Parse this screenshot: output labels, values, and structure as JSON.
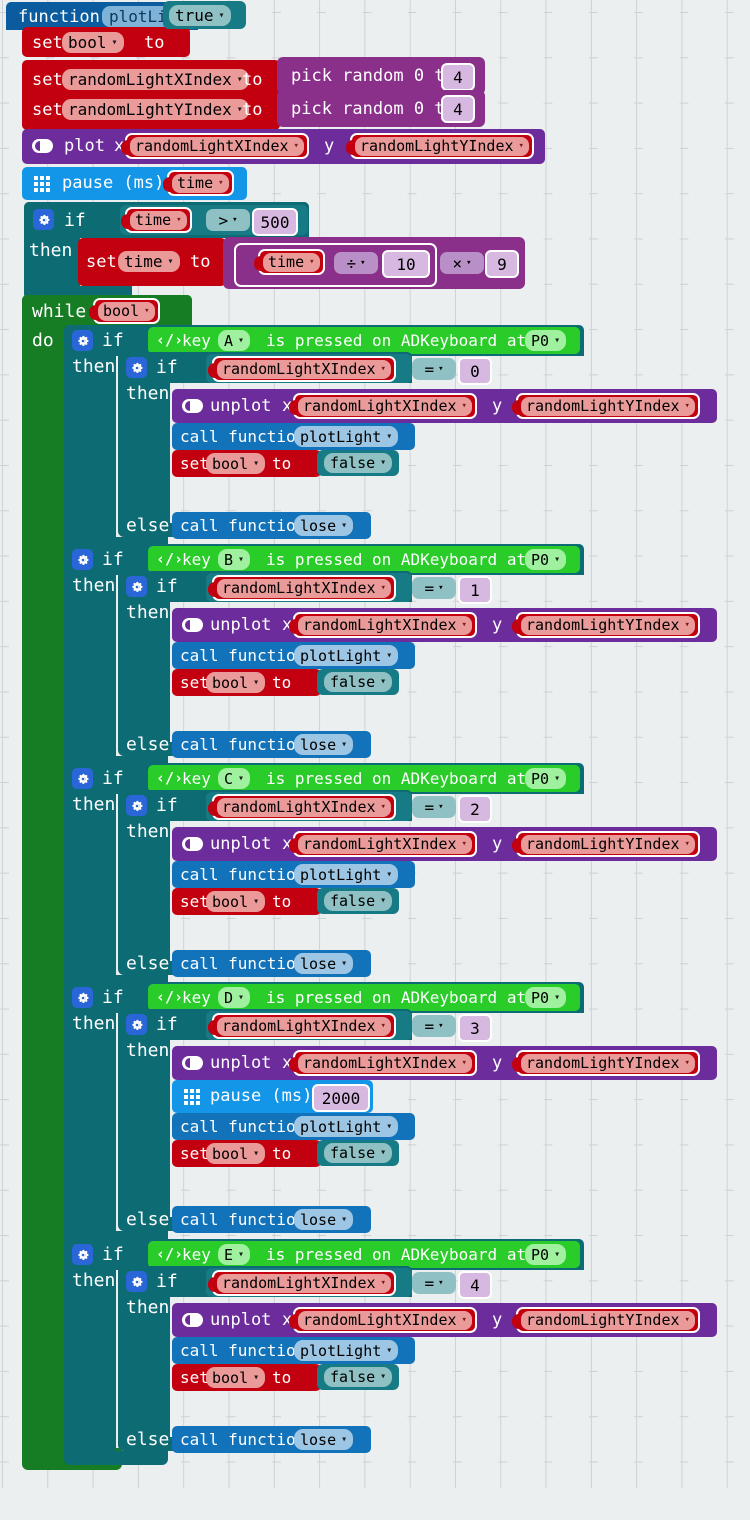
{
  "workspace": {
    "background_color": "#eceff0",
    "grid_dot_color": "#cdd2d4"
  },
  "palette": {
    "function": "#0b5c9e",
    "variables": "#c2000f",
    "logic": "#177b86",
    "led": "#6c2c9c",
    "basic": "#1396e8",
    "loops": "#177d25",
    "control": "#0d6b74",
    "extension": "#29cc29",
    "math": "#8a2f8a",
    "call": "#1273ba"
  },
  "function_block": {
    "keyword": "function",
    "name": "plotLight"
  },
  "setup": {
    "set_bool": {
      "keyword": "set",
      "variable": "bool",
      "to": "to",
      "value": "true"
    },
    "set_x": {
      "keyword": "set",
      "variable": "randomLightXIndex",
      "to": "to",
      "random": {
        "label": "pick random 0 to",
        "max": "4"
      }
    },
    "set_y": {
      "keyword": "set",
      "variable": "randomLightYIndex",
      "to": "to",
      "random": {
        "label": "pick random 0 to",
        "max": "4"
      }
    },
    "plot": {
      "label": "plot",
      "x_label": "x",
      "x_var": "randomLightXIndex",
      "y_label": "y",
      "y_var": "randomLightYIndex"
    },
    "pause": {
      "label": "pause (ms)",
      "value": "time"
    }
  },
  "time_if": {
    "if": "if",
    "then": "then",
    "condition": {
      "left": "time",
      "operator": ">",
      "right": "500"
    },
    "body": {
      "keyword": "set",
      "variable": "time",
      "to": "to",
      "expr": {
        "left": "time",
        "op1": "÷",
        "mid": "10",
        "op2": "×",
        "right": "9"
      }
    }
  },
  "while_loop": {
    "while": "while",
    "do": "do",
    "condition": "bool"
  },
  "key_branches": [
    {
      "if": "if",
      "then": "then",
      "else": "else",
      "key_label_pre": "key",
      "key": "A",
      "key_label_post": "is pressed on ADKeyboard at pin",
      "pin": "P0",
      "inner_if": "if",
      "inner_then": "then",
      "compare": {
        "left": "randomLightXIndex",
        "operator": "=",
        "right": "0"
      },
      "unplot": {
        "label": "unplot",
        "x_label": "x",
        "x_var": "randomLightXIndex",
        "y_label": "y",
        "y_var": "randomLightYIndex"
      },
      "pause": null,
      "call_plot": {
        "label": "call function",
        "name": "plotLight"
      },
      "set_bool": {
        "keyword": "set",
        "variable": "bool",
        "to": "to",
        "value": "false"
      },
      "call_lose": {
        "label": "call function",
        "name": "lose"
      }
    },
    {
      "if": "if",
      "then": "then",
      "else": "else",
      "key_label_pre": "key",
      "key": "B",
      "key_label_post": "is pressed on ADKeyboard at pin",
      "pin": "P0",
      "inner_if": "if",
      "inner_then": "then",
      "compare": {
        "left": "randomLightXIndex",
        "operator": "=",
        "right": "1"
      },
      "unplot": {
        "label": "unplot",
        "x_label": "x",
        "x_var": "randomLightXIndex",
        "y_label": "y",
        "y_var": "randomLightYIndex"
      },
      "pause": null,
      "call_plot": {
        "label": "call function",
        "name": "plotLight"
      },
      "set_bool": {
        "keyword": "set",
        "variable": "bool",
        "to": "to",
        "value": "false"
      },
      "call_lose": {
        "label": "call function",
        "name": "lose"
      }
    },
    {
      "if": "if",
      "then": "then",
      "else": "else",
      "key_label_pre": "key",
      "key": "C",
      "key_label_post": "is pressed on ADKeyboard at pin",
      "pin": "P0",
      "inner_if": "if",
      "inner_then": "then",
      "compare": {
        "left": "randomLightXIndex",
        "operator": "=",
        "right": "2"
      },
      "unplot": {
        "label": "unplot",
        "x_label": "x",
        "x_var": "randomLightXIndex",
        "y_label": "y",
        "y_var": "randomLightYIndex"
      },
      "pause": null,
      "call_plot": {
        "label": "call function",
        "name": "plotLight"
      },
      "set_bool": {
        "keyword": "set",
        "variable": "bool",
        "to": "to",
        "value": "false"
      },
      "call_lose": {
        "label": "call function",
        "name": "lose"
      }
    },
    {
      "if": "if",
      "then": "then",
      "else": "else",
      "key_label_pre": "key",
      "key": "D",
      "key_label_post": "is pressed on ADKeyboard at pin",
      "pin": "P0",
      "inner_if": "if",
      "inner_then": "then",
      "compare": {
        "left": "randomLightXIndex",
        "operator": "=",
        "right": "3"
      },
      "unplot": {
        "label": "unplot",
        "x_label": "x",
        "x_var": "randomLightXIndex",
        "y_label": "y",
        "y_var": "randomLightYIndex"
      },
      "pause": {
        "label": "pause (ms)",
        "value": "2000"
      },
      "call_plot": {
        "label": "call function",
        "name": "plotLight"
      },
      "set_bool": {
        "keyword": "set",
        "variable": "bool",
        "to": "to",
        "value": "false"
      },
      "call_lose": {
        "label": "call function",
        "name": "lose"
      }
    },
    {
      "if": "if",
      "then": "then",
      "else": "else",
      "key_label_pre": "key",
      "key": "E",
      "key_label_post": "is pressed on ADKeyboard at pin",
      "pin": "P0",
      "inner_if": "if",
      "inner_then": "then",
      "compare": {
        "left": "randomLightXIndex",
        "operator": "=",
        "right": "4"
      },
      "unplot": {
        "label": "unplot",
        "x_label": "x",
        "x_var": "randomLightXIndex",
        "y_label": "y",
        "y_var": "randomLightYIndex"
      },
      "pause": null,
      "call_plot": {
        "label": "call function",
        "name": "plotLight"
      },
      "set_bool": {
        "keyword": "set",
        "variable": "bool",
        "to": "to",
        "value": "false"
      },
      "call_lose": {
        "label": "call function",
        "name": "lose"
      }
    }
  ],
  "icons": {
    "gear": "gear-icon",
    "led_matrix": "led-matrix-icon",
    "plot_dot": "plot-dot-icon",
    "code": "code-brackets-icon",
    "dropdown": "▾"
  }
}
